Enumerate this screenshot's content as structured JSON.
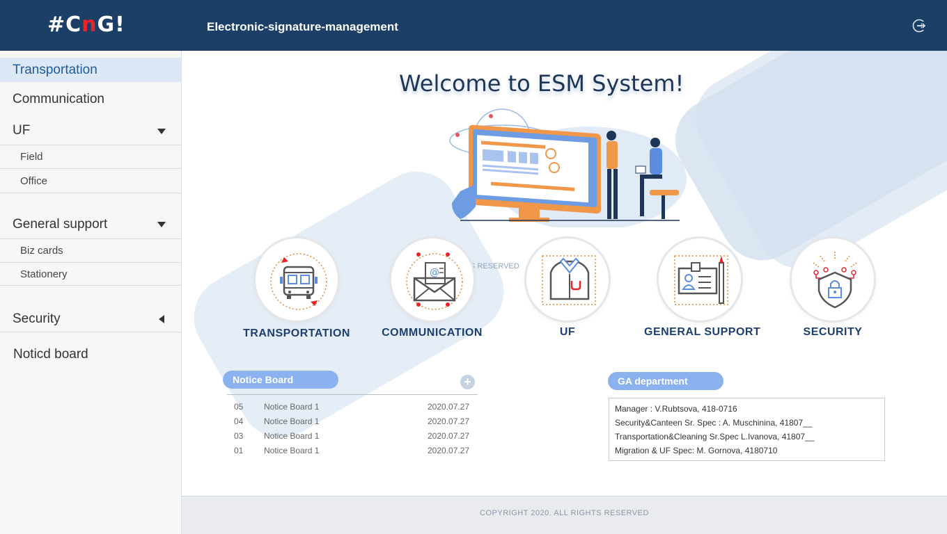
{
  "header": {
    "logo_prefix": "#C",
    "logo_accent": "n",
    "logo_suffix": "G!",
    "app_title": "Electronic-signature-management",
    "logout_icon": "logout-icon"
  },
  "sidebar": {
    "transportation": "Transportation",
    "communication": "Communication",
    "uf": "UF",
    "field": "Field",
    "office": "Office",
    "general_support": "General support",
    "biz_cards": "Biz cards",
    "stationery": "Stationery",
    "security": "Security",
    "notice_board": "Noticd board"
  },
  "main": {
    "welcome": "Welcome to ESM System!",
    "ghost_text": "S RESERVED",
    "categories": [
      {
        "label": "TRANSPORTATION",
        "icon": "bus-icon"
      },
      {
        "label": "COMMUNICATION",
        "icon": "mail-icon"
      },
      {
        "label": "UF",
        "icon": "uniform-icon"
      },
      {
        "label": "GENERAL  SUPPORT",
        "icon": "id-card-icon"
      },
      {
        "label": "SECURITY",
        "icon": "shield-lock-icon"
      }
    ]
  },
  "notice_board": {
    "title": "Notice Board",
    "add_label": "+",
    "rows": [
      {
        "no": "05",
        "title": "Notice Board 1",
        "date": "2020.07.27"
      },
      {
        "no": "04",
        "title": "Notice Board 1",
        "date": "2020.07.27"
      },
      {
        "no": "03",
        "title": "Notice Board 1",
        "date": "2020.07.27"
      },
      {
        "no": "01",
        "title": "Notice Board 1",
        "date": "2020.07.27"
      }
    ]
  },
  "ga": {
    "title": "GA department",
    "lines": [
      "Manager    :   V.Rubtsova, 418-0716",
      "Security&Canteen Sr. Spec     :     A. Muschinina, 41807__",
      "Transportation&Cleaning Sr.Spec L.Ivanova, 41807__",
      "Migration & UF Spec: M. Gornova, 4180710"
    ]
  },
  "footer": {
    "copyright": "COPYRIGHT 2020.  ALL RIGHTS RESERVED"
  },
  "colors": {
    "header_bg": "#1b3f66",
    "accent_red": "#e8242a",
    "pill_blue": "#8bb2ef",
    "label_navy": "#1d3f6e",
    "active_bg": "#dce8f6"
  }
}
